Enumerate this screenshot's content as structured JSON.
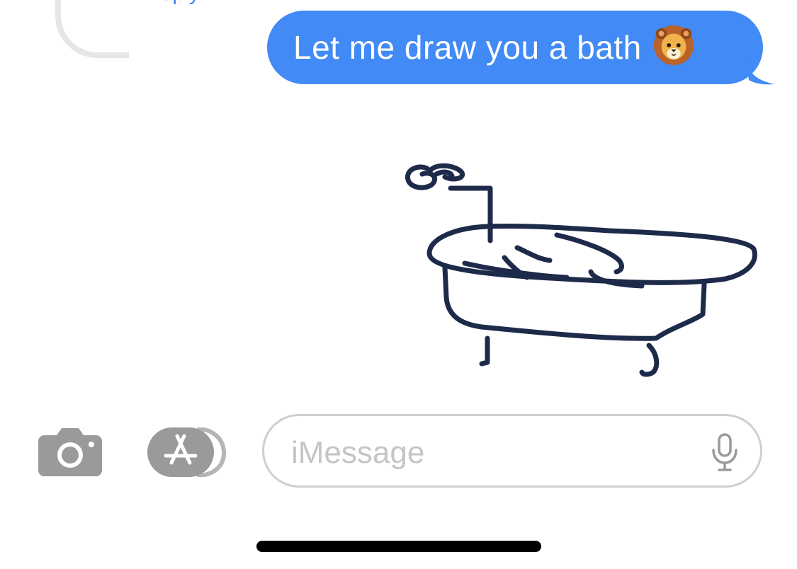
{
  "thread": {
    "reply_label": "Reply"
  },
  "message": {
    "text": "Let me draw you a bath",
    "emoji": "lion-face-emoji",
    "bubble_color": "#428af5"
  },
  "sketch": {
    "subject": "bathtub",
    "ink_color": "#1e2a4a"
  },
  "compose": {
    "placeholder": "iMessage",
    "camera_icon": "camera-icon",
    "apps_icon": "app-store-icon",
    "mic_icon": "microphone-icon"
  },
  "colors": {
    "accent": "#428af5",
    "icon_gray": "#9a9a9c",
    "field_border": "#cfcfd1",
    "placeholder": "#c5c5c7"
  }
}
